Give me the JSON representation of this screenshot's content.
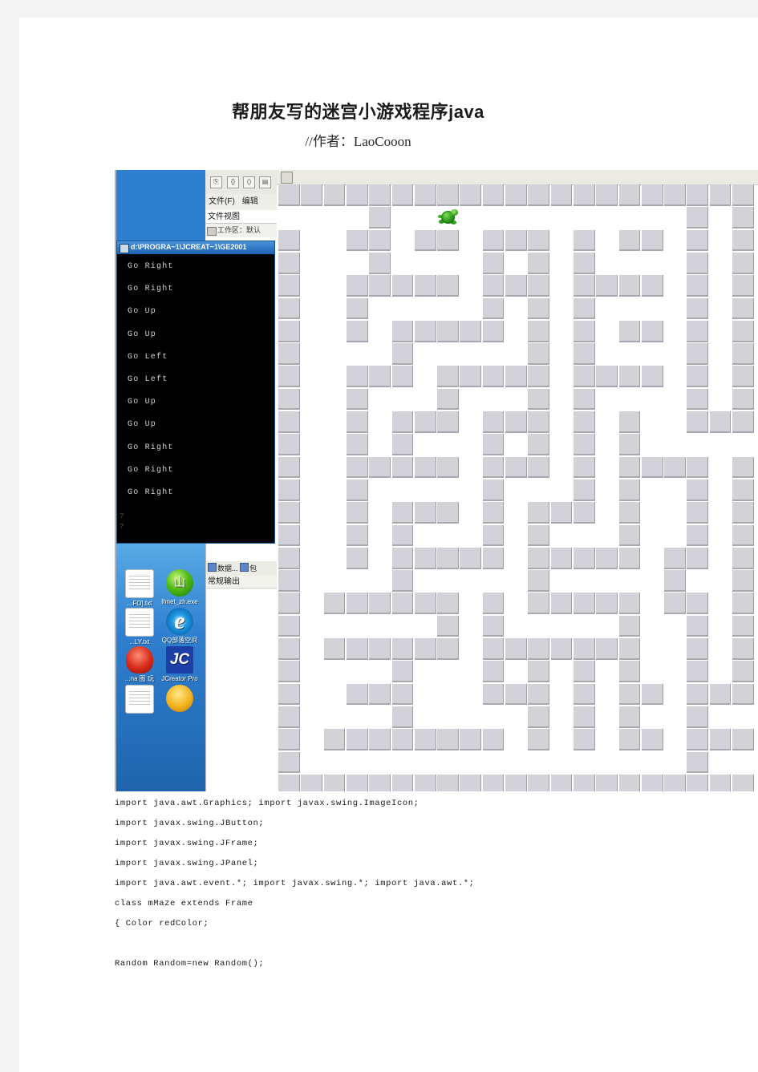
{
  "document": {
    "title": "帮朋友写的迷宫小游戏程序java",
    "subtitle": "//作者：LaoCooon"
  },
  "screenshot": {
    "ide": {
      "toolbar_buttons": [
        "⎘",
        "{}",
        "()",
        "▤"
      ],
      "menu_items": [
        "文件(F)",
        "编辑"
      ],
      "file_view_label": "文件视图",
      "workspace_label": "工作区：默认",
      "window_title": "d:\\PROGRA~1\\JCREAT~1\\GE2001",
      "lower_tabs": [
        "数据...",
        "包"
      ],
      "output_label": "常规输出"
    },
    "console": {
      "lines": [
        "Go Right",
        "Go Right",
        "Go Up",
        "Go Up",
        "Go Left",
        "Go Left",
        "Go Up",
        "Go Up",
        "Go Right",
        "Go Right",
        "Go Right"
      ],
      "tail_lines": [
        "?",
        "?"
      ]
    },
    "desktop_icons": [
      {
        "label": "...FO].txt",
        "glyph": "document-icon",
        "kind": "doc"
      },
      {
        "label": "lhnet_zh.exe",
        "glyph": "green-ball-icon",
        "kind": "green"
      },
      {
        "label": "...LY.txt",
        "glyph": "document-icon",
        "kind": "doc"
      },
      {
        "label": "QQ部落空间",
        "glyph": "internet-explorer-icon",
        "kind": "ie"
      },
      {
        "label": "...na 图\n玩",
        "glyph": "red-character-icon",
        "kind": "red"
      },
      {
        "label": "JCreator\nPro",
        "glyph": "jcreator-icon",
        "kind": "jc"
      },
      {
        "label": "",
        "glyph": "document-icon",
        "kind": "doc"
      },
      {
        "label": "",
        "glyph": "yellow-ball-icon",
        "kind": "yellow"
      }
    ],
    "maze": {
      "cols": 21,
      "rows": 27,
      "cell": 28.3,
      "wall_color": "#d2d2d8",
      "path_color": "#ffffff",
      "player": {
        "name": "turtle-sprite",
        "col": 7,
        "row": 1
      },
      "walls": [
        [
          0,
          0
        ],
        [
          1,
          0
        ],
        [
          2,
          0
        ],
        [
          3,
          0
        ],
        [
          4,
          0
        ],
        [
          5,
          0
        ],
        [
          6,
          0
        ],
        [
          7,
          0
        ],
        [
          8,
          0
        ],
        [
          9,
          0
        ],
        [
          10,
          0
        ],
        [
          11,
          0
        ],
        [
          12,
          0
        ],
        [
          13,
          0
        ],
        [
          14,
          0
        ],
        [
          15,
          0
        ],
        [
          16,
          0
        ],
        [
          17,
          0
        ],
        [
          18,
          0
        ],
        [
          19,
          0
        ],
        [
          20,
          0
        ],
        [
          4,
          1
        ],
        [
          18,
          1
        ],
        [
          20,
          1
        ],
        [
          0,
          2
        ],
        [
          3,
          2
        ],
        [
          4,
          2
        ],
        [
          6,
          2
        ],
        [
          7,
          2
        ],
        [
          9,
          2
        ],
        [
          10,
          2
        ],
        [
          11,
          2
        ],
        [
          13,
          2
        ],
        [
          15,
          2
        ],
        [
          16,
          2
        ],
        [
          18,
          2
        ],
        [
          20,
          2
        ],
        [
          0,
          3
        ],
        [
          4,
          3
        ],
        [
          9,
          3
        ],
        [
          11,
          3
        ],
        [
          13,
          3
        ],
        [
          18,
          3
        ],
        [
          20,
          3
        ],
        [
          0,
          4
        ],
        [
          3,
          4
        ],
        [
          4,
          4
        ],
        [
          5,
          4
        ],
        [
          6,
          4
        ],
        [
          7,
          4
        ],
        [
          9,
          4
        ],
        [
          10,
          4
        ],
        [
          11,
          4
        ],
        [
          13,
          4
        ],
        [
          14,
          4
        ],
        [
          15,
          4
        ],
        [
          16,
          4
        ],
        [
          18,
          4
        ],
        [
          20,
          4
        ],
        [
          0,
          5
        ],
        [
          3,
          5
        ],
        [
          9,
          5
        ],
        [
          11,
          5
        ],
        [
          13,
          5
        ],
        [
          18,
          5
        ],
        [
          20,
          5
        ],
        [
          0,
          6
        ],
        [
          3,
          6
        ],
        [
          5,
          6
        ],
        [
          6,
          6
        ],
        [
          7,
          6
        ],
        [
          8,
          6
        ],
        [
          9,
          6
        ],
        [
          11,
          6
        ],
        [
          13,
          6
        ],
        [
          15,
          6
        ],
        [
          16,
          6
        ],
        [
          18,
          6
        ],
        [
          20,
          6
        ],
        [
          0,
          7
        ],
        [
          5,
          7
        ],
        [
          11,
          7
        ],
        [
          13,
          7
        ],
        [
          18,
          7
        ],
        [
          20,
          7
        ],
        [
          0,
          8
        ],
        [
          3,
          8
        ],
        [
          4,
          8
        ],
        [
          5,
          8
        ],
        [
          7,
          8
        ],
        [
          8,
          8
        ],
        [
          9,
          8
        ],
        [
          10,
          8
        ],
        [
          11,
          8
        ],
        [
          13,
          8
        ],
        [
          14,
          8
        ],
        [
          15,
          8
        ],
        [
          16,
          8
        ],
        [
          18,
          8
        ],
        [
          20,
          8
        ],
        [
          0,
          9
        ],
        [
          3,
          9
        ],
        [
          7,
          9
        ],
        [
          11,
          9
        ],
        [
          13,
          9
        ],
        [
          18,
          9
        ],
        [
          20,
          9
        ],
        [
          0,
          10
        ],
        [
          3,
          10
        ],
        [
          5,
          10
        ],
        [
          6,
          10
        ],
        [
          7,
          10
        ],
        [
          9,
          10
        ],
        [
          10,
          10
        ],
        [
          11,
          10
        ],
        [
          13,
          10
        ],
        [
          15,
          10
        ],
        [
          18,
          10
        ],
        [
          19,
          10
        ],
        [
          20,
          10
        ],
        [
          0,
          11
        ],
        [
          3,
          11
        ],
        [
          5,
          11
        ],
        [
          9,
          11
        ],
        [
          11,
          11
        ],
        [
          13,
          11
        ],
        [
          15,
          11
        ],
        [
          0,
          12
        ],
        [
          3,
          12
        ],
        [
          4,
          12
        ],
        [
          5,
          12
        ],
        [
          6,
          12
        ],
        [
          7,
          12
        ],
        [
          9,
          12
        ],
        [
          10,
          12
        ],
        [
          11,
          12
        ],
        [
          13,
          12
        ],
        [
          15,
          12
        ],
        [
          16,
          12
        ],
        [
          17,
          12
        ],
        [
          18,
          12
        ],
        [
          20,
          12
        ],
        [
          0,
          13
        ],
        [
          3,
          13
        ],
        [
          9,
          13
        ],
        [
          13,
          13
        ],
        [
          15,
          13
        ],
        [
          18,
          13
        ],
        [
          20,
          13
        ],
        [
          0,
          14
        ],
        [
          3,
          14
        ],
        [
          5,
          14
        ],
        [
          6,
          14
        ],
        [
          7,
          14
        ],
        [
          9,
          14
        ],
        [
          11,
          14
        ],
        [
          12,
          14
        ],
        [
          13,
          14
        ],
        [
          15,
          14
        ],
        [
          18,
          14
        ],
        [
          20,
          14
        ],
        [
          0,
          15
        ],
        [
          3,
          15
        ],
        [
          5,
          15
        ],
        [
          9,
          15
        ],
        [
          11,
          15
        ],
        [
          15,
          15
        ],
        [
          18,
          15
        ],
        [
          20,
          15
        ],
        [
          0,
          16
        ],
        [
          3,
          16
        ],
        [
          5,
          16
        ],
        [
          6,
          16
        ],
        [
          7,
          16
        ],
        [
          8,
          16
        ],
        [
          9,
          16
        ],
        [
          11,
          16
        ],
        [
          12,
          16
        ],
        [
          13,
          16
        ],
        [
          14,
          16
        ],
        [
          15,
          16
        ],
        [
          17,
          16
        ],
        [
          18,
          16
        ],
        [
          20,
          16
        ],
        [
          0,
          17
        ],
        [
          5,
          17
        ],
        [
          11,
          17
        ],
        [
          17,
          17
        ],
        [
          20,
          17
        ],
        [
          0,
          18
        ],
        [
          2,
          18
        ],
        [
          3,
          18
        ],
        [
          4,
          18
        ],
        [
          5,
          18
        ],
        [
          6,
          18
        ],
        [
          7,
          18
        ],
        [
          9,
          18
        ],
        [
          11,
          18
        ],
        [
          12,
          18
        ],
        [
          13,
          18
        ],
        [
          14,
          18
        ],
        [
          15,
          18
        ],
        [
          17,
          18
        ],
        [
          18,
          18
        ],
        [
          20,
          18
        ],
        [
          0,
          19
        ],
        [
          7,
          19
        ],
        [
          9,
          19
        ],
        [
          15,
          19
        ],
        [
          18,
          19
        ],
        [
          20,
          19
        ],
        [
          0,
          20
        ],
        [
          2,
          20
        ],
        [
          3,
          20
        ],
        [
          4,
          20
        ],
        [
          5,
          20
        ],
        [
          6,
          20
        ],
        [
          7,
          20
        ],
        [
          9,
          20
        ],
        [
          10,
          20
        ],
        [
          11,
          20
        ],
        [
          12,
          20
        ],
        [
          13,
          20
        ],
        [
          14,
          20
        ],
        [
          15,
          20
        ],
        [
          18,
          20
        ],
        [
          20,
          20
        ],
        [
          0,
          21
        ],
        [
          5,
          21
        ],
        [
          9,
          21
        ],
        [
          11,
          21
        ],
        [
          13,
          21
        ],
        [
          15,
          21
        ],
        [
          18,
          21
        ],
        [
          20,
          21
        ],
        [
          0,
          22
        ],
        [
          3,
          22
        ],
        [
          4,
          22
        ],
        [
          5,
          22
        ],
        [
          9,
          22
        ],
        [
          10,
          22
        ],
        [
          11,
          22
        ],
        [
          13,
          22
        ],
        [
          15,
          22
        ],
        [
          16,
          22
        ],
        [
          18,
          22
        ],
        [
          19,
          22
        ],
        [
          20,
          22
        ],
        [
          0,
          23
        ],
        [
          5,
          23
        ],
        [
          11,
          23
        ],
        [
          13,
          23
        ],
        [
          15,
          23
        ],
        [
          18,
          23
        ],
        [
          0,
          24
        ],
        [
          2,
          24
        ],
        [
          3,
          24
        ],
        [
          4,
          24
        ],
        [
          5,
          24
        ],
        [
          6,
          24
        ],
        [
          7,
          24
        ],
        [
          8,
          24
        ],
        [
          9,
          24
        ],
        [
          11,
          24
        ],
        [
          13,
          24
        ],
        [
          15,
          24
        ],
        [
          16,
          24
        ],
        [
          18,
          24
        ],
        [
          19,
          24
        ],
        [
          20,
          24
        ],
        [
          0,
          25
        ],
        [
          18,
          25
        ],
        [
          0,
          26
        ],
        [
          1,
          26
        ],
        [
          2,
          26
        ],
        [
          3,
          26
        ],
        [
          4,
          26
        ],
        [
          5,
          26
        ],
        [
          6,
          26
        ],
        [
          7,
          26
        ],
        [
          8,
          26
        ],
        [
          9,
          26
        ],
        [
          10,
          26
        ],
        [
          11,
          26
        ],
        [
          12,
          26
        ],
        [
          13,
          26
        ],
        [
          14,
          26
        ],
        [
          15,
          26
        ],
        [
          16,
          26
        ],
        [
          17,
          26
        ],
        [
          18,
          26
        ],
        [
          19,
          26
        ],
        [
          20,
          26
        ]
      ]
    }
  },
  "code": {
    "lines": [
      "import java.awt.Graphics; import javax.swing.ImageIcon;",
      "import javax.swing.JButton;",
      "import javax.swing.JFrame;",
      "import javax.swing.JPanel;",
      "import java.awt.event.*; import javax.swing.*; import java.awt.*;",
      "class mMaze extends Frame",
      "{ Color redColor;",
      "",
      "Random Random=new Random();"
    ]
  }
}
